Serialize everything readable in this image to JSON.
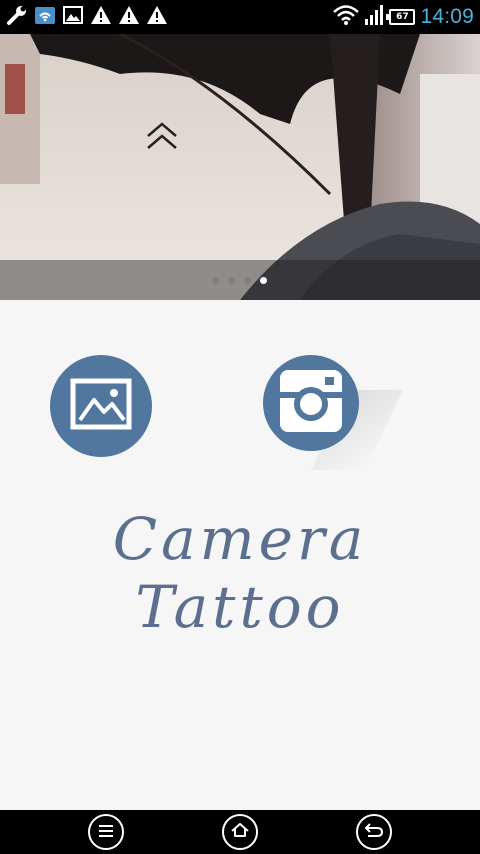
{
  "status_bar": {
    "time": "14:09",
    "battery_level": "67",
    "left_icons": [
      "wrench-icon",
      "sd-card-wifi-icon",
      "image-icon",
      "warning-icon",
      "warning-icon",
      "warning-icon"
    ],
    "right_icons": [
      "wifi-icon",
      "signal-icon",
      "battery-icon"
    ]
  },
  "banner": {
    "slide_count": 4,
    "active_slide": 4
  },
  "actions": {
    "gallery": "gallery-icon",
    "camera": "camera-icon"
  },
  "title": "Camera Tattoo",
  "nav": {
    "menu": "menu-icon",
    "home": "home-icon",
    "back": "back-icon"
  },
  "colors": {
    "accent": "#52779e",
    "title_text": "#5d6f8f",
    "clock": "#4ab0de"
  }
}
